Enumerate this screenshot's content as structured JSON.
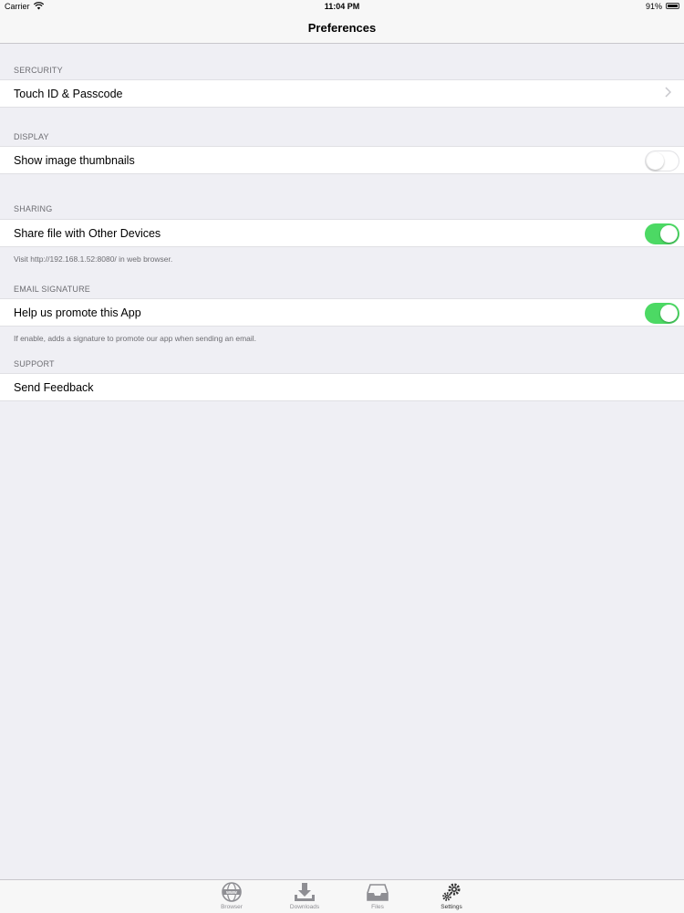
{
  "status_bar": {
    "carrier": "Carrier",
    "time": "11:04 PM",
    "battery": "91%"
  },
  "nav": {
    "title": "Preferences"
  },
  "sections": {
    "security": {
      "header": "SERCURITY",
      "row": "Touch ID & Passcode"
    },
    "display": {
      "header": "DISPLAY",
      "row": "Show image thumbnails",
      "toggle_on": false
    },
    "sharing": {
      "header": "SHARING",
      "row": "Share file with Other Devices",
      "toggle_on": true,
      "footer": "Visit http://192.168.1.52:8080/ in web browser."
    },
    "email_signature": {
      "header": "EMAIL SIGNATURE",
      "row": "Help us promote this App",
      "toggle_on": true,
      "footer": "If enable, adds a signature to promote our app when sending an email."
    },
    "support": {
      "header": "SUPPORT",
      "row": "Send Feedback"
    }
  },
  "tabs": [
    {
      "label": "Browser",
      "icon": "globe-icon",
      "active": false
    },
    {
      "label": "Downloads",
      "icon": "download-icon",
      "active": false
    },
    {
      "label": "Files",
      "icon": "tray-icon",
      "active": false
    },
    {
      "label": "Settings",
      "icon": "gears-icon",
      "active": true
    }
  ],
  "colors": {
    "toggle_on": "#4cd964",
    "background": "#efeff4",
    "section_text": "#6d6d72"
  }
}
